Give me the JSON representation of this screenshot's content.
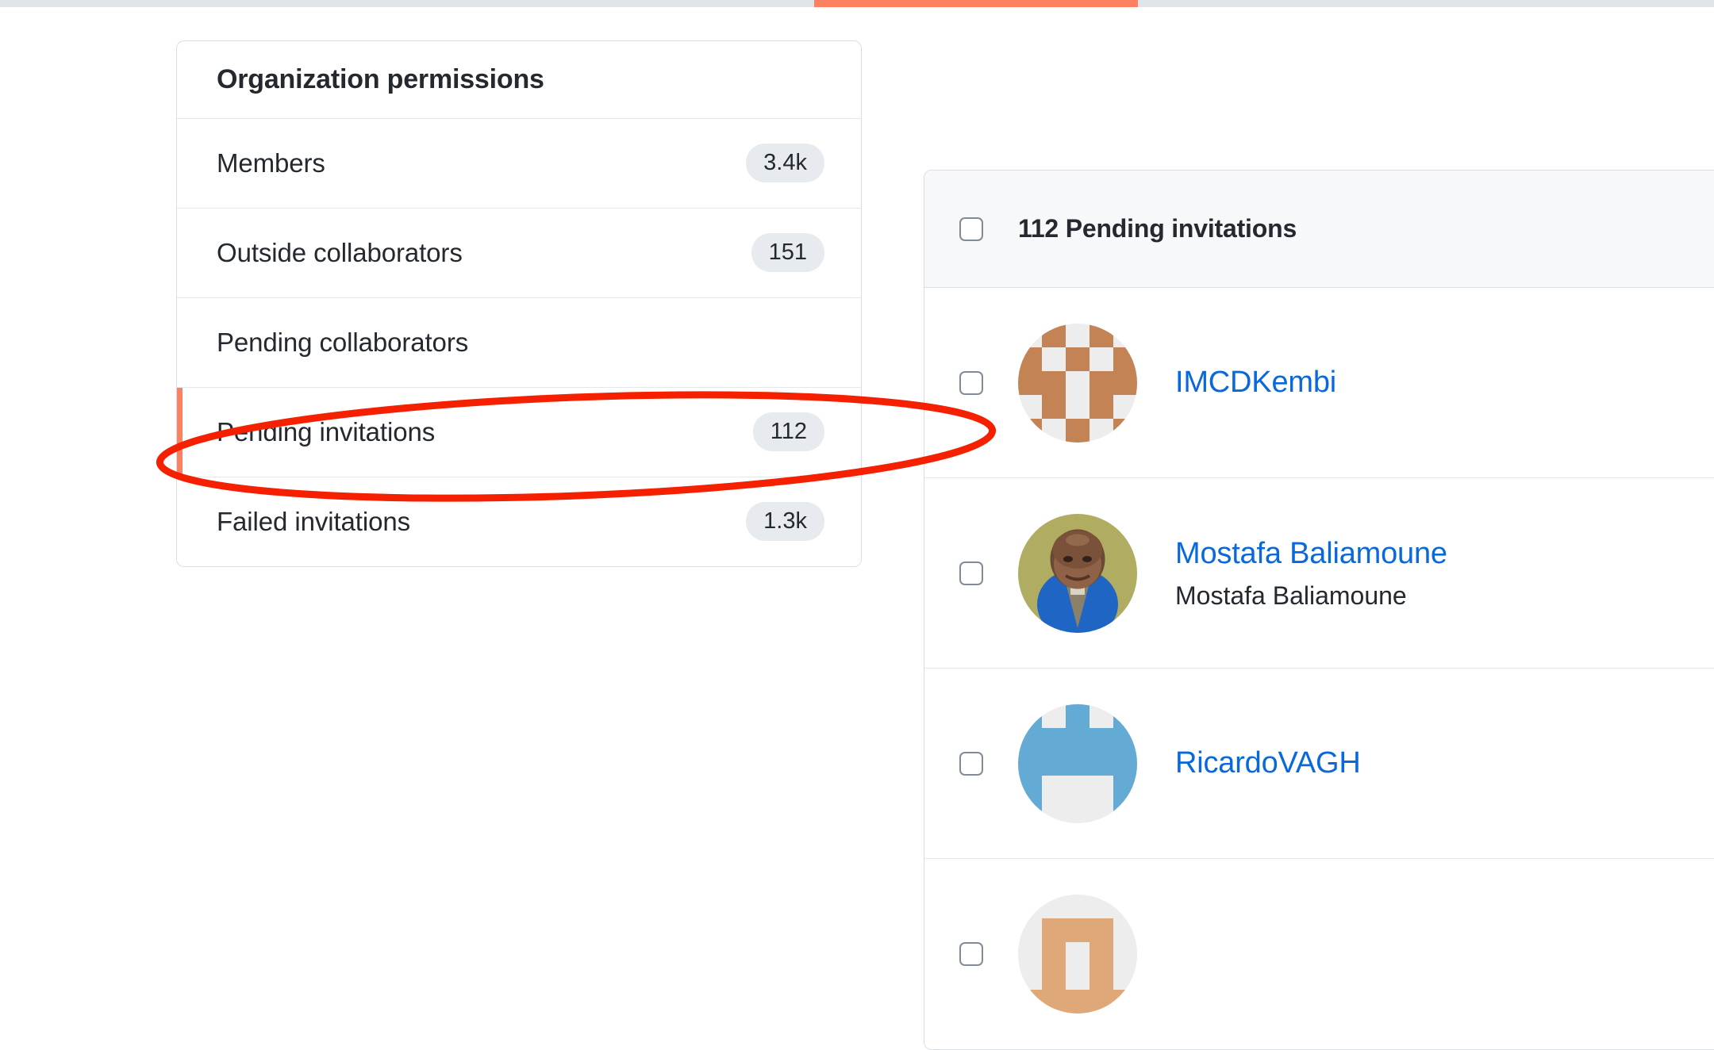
{
  "top_tabs": {
    "active_tab_indicator_color": "#fc8161"
  },
  "org_permissions_card": {
    "title": "Organization permissions",
    "selected_item": "Pending invitations",
    "selection_indicator_color": "#fc8161",
    "items": [
      {
        "label": "Members",
        "count": "3.4k"
      },
      {
        "label": "Outside collaborators",
        "count": "151"
      },
      {
        "label": "Pending collaborators",
        "count": ""
      },
      {
        "label": "Pending invitations",
        "count": "112"
      },
      {
        "label": "Failed invitations",
        "count": "1.3k"
      }
    ]
  },
  "pending_invitations_panel": {
    "header": {
      "title": "112 Pending invitations",
      "count": "112",
      "select_all_checked": false
    },
    "rows": [
      {
        "login": "IMCDKembi",
        "name": "",
        "avatar_type": "identicon",
        "avatar_color": "#c48354",
        "checked": false
      },
      {
        "login": "Mostafa Baliamoune",
        "name": "Mostafa Baliamoune",
        "avatar_type": "photo",
        "avatar_color": "#b0ac62",
        "checked": false
      },
      {
        "login": "RicardoVAGH",
        "name": "",
        "avatar_type": "identicon",
        "avatar_color": "#63abd4",
        "checked": false
      },
      {
        "login": "",
        "name": "",
        "avatar_type": "identicon",
        "avatar_color": "#dfa878",
        "checked": false
      }
    ]
  },
  "annotation": {
    "shape": "ellipse",
    "color": "#f42000",
    "targets": "Pending invitations"
  },
  "colors": {
    "link": "#0969da",
    "text": "#24292f",
    "border": "#d8dee4",
    "counter_bg": "#e7eaee",
    "header_bg": "#f6f8fa",
    "accent_orange": "#fc8161",
    "annotation_red": "#f42000"
  }
}
